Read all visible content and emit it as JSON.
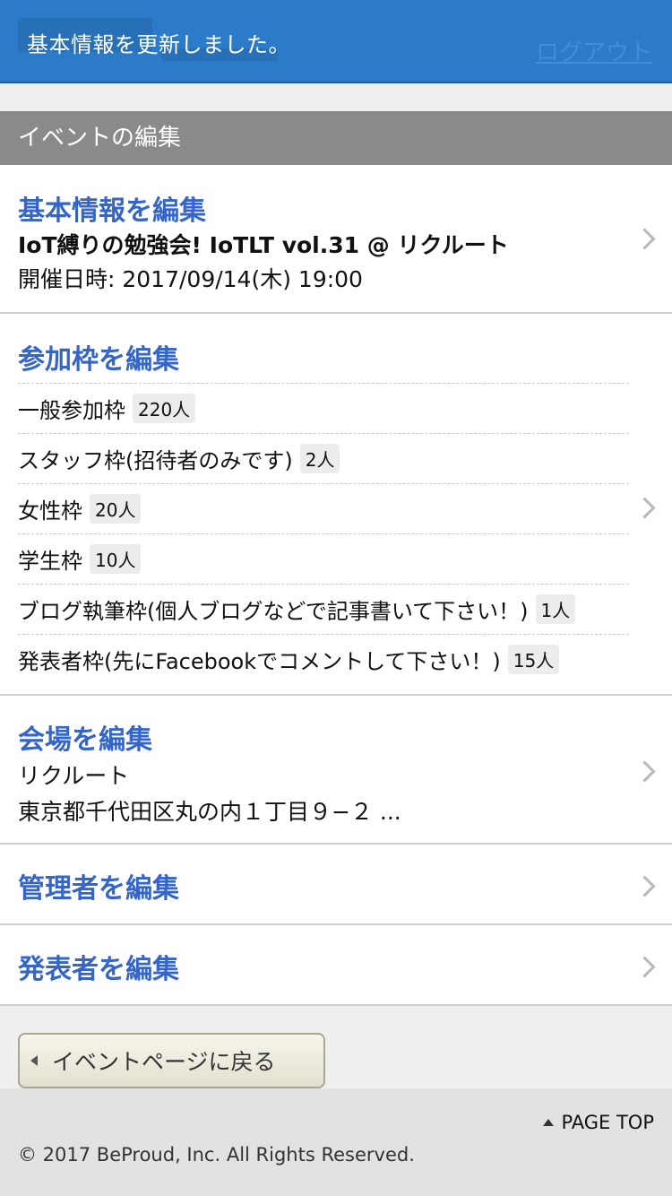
{
  "header": {
    "notice": "基本情報を更新しました。",
    "logout_label": "ログアウト"
  },
  "section_title": "イベントの編集",
  "basic_info": {
    "heading": "基本情報を編集",
    "event_title": "IoT縛りの勉強会! IoTLT vol.31 @ リクルート",
    "datetime": "開催日時: 2017/09/14(木) 19:00"
  },
  "quotas": {
    "heading": "参加枠を編集",
    "items": [
      {
        "label": "一般参加枠",
        "count": "220人"
      },
      {
        "label": "スタッフ枠(招待者のみです)",
        "count": "2人"
      },
      {
        "label": "女性枠",
        "count": "20人"
      },
      {
        "label": "学生枠",
        "count": "10人"
      },
      {
        "label": "ブログ執筆枠(個人ブログなどで記事書いて下さい！)",
        "count": "1人"
      },
      {
        "label": "発表者枠(先にFacebookでコメントして下さい！)",
        "count": "15人"
      }
    ]
  },
  "venue": {
    "heading": "会場を編集",
    "name": "リクルート",
    "address": "東京都千代田区丸の内１丁目９−２ ..."
  },
  "admins": {
    "heading": "管理者を編集"
  },
  "presenters": {
    "heading": "発表者を編集"
  },
  "back_button": "イベントページに戻る",
  "footer": {
    "page_top": "PAGE TOP",
    "copyright": "© 2017 BeProud, Inc. All Rights Reserved."
  }
}
